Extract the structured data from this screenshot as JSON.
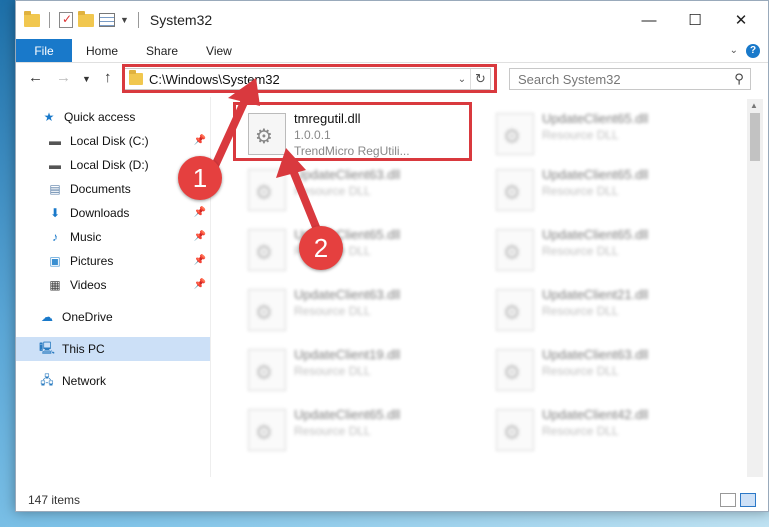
{
  "window": {
    "title": "System32"
  },
  "ribbon": {
    "tabs": [
      {
        "label": "File"
      },
      {
        "label": "Home"
      },
      {
        "label": "Share"
      },
      {
        "label": "View"
      }
    ]
  },
  "nav": {
    "address": "C:\\Windows\\System32",
    "search_placeholder": "Search System32"
  },
  "sidebar": {
    "items": [
      {
        "label": "Quick access",
        "icon": "star-icon"
      },
      {
        "label": "Local Disk (C:)",
        "icon": "drive-icon",
        "pinned": true
      },
      {
        "label": "Local Disk (D:)",
        "icon": "drive-icon",
        "pinned": false
      },
      {
        "label": "Documents",
        "icon": "documents-icon",
        "pinned": false
      },
      {
        "label": "Downloads",
        "icon": "download-icon",
        "pinned": true
      },
      {
        "label": "Music",
        "icon": "music-icon",
        "pinned": true
      },
      {
        "label": "Pictures",
        "icon": "pictures-icon",
        "pinned": true
      },
      {
        "label": "Videos",
        "icon": "videos-icon",
        "pinned": true
      },
      {
        "label": "OneDrive",
        "icon": "cloud-icon"
      },
      {
        "label": "This PC",
        "icon": "computer-icon"
      },
      {
        "label": "Network",
        "icon": "network-icon"
      }
    ]
  },
  "files": {
    "highlighted": {
      "name": "tmregutil.dll",
      "version": "1.0.0.1",
      "description": "TrendMicro RegUtili..."
    },
    "tiles": [
      {
        "name": "UpdateClient65.dll",
        "type": "Resource DLL"
      },
      {
        "name": "UpdateClient63.dll",
        "type": "Resource DLL"
      },
      {
        "name": "UpdateClient65.dll",
        "type": "Resource DLL"
      },
      {
        "name": "UpdateClient65.dll",
        "type": "Resource DLL"
      },
      {
        "name": "UpdateClient65.dll",
        "type": "Resource DLL"
      },
      {
        "name": "UpdateClient63.dll",
        "type": "Resource DLL"
      },
      {
        "name": "UpdateClient21.dll",
        "type": "Resource DLL"
      },
      {
        "name": "UpdateClient19.dll",
        "type": "Resource DLL"
      },
      {
        "name": "UpdateClient63.dll",
        "type": "Resource DLL"
      },
      {
        "name": "UpdateClient65.dll",
        "type": "Resource DLL"
      },
      {
        "name": "UpdateClient42.dll",
        "type": "Resource DLL"
      }
    ]
  },
  "status": {
    "item_count": "147 items"
  },
  "annotations": {
    "badge1": "1",
    "badge2": "2",
    "color": "#d9393e"
  }
}
